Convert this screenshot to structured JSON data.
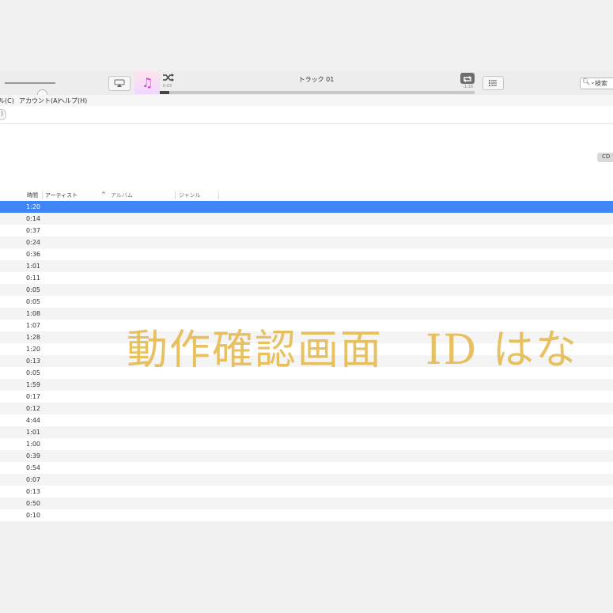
{
  "toolbar": {
    "now_playing_title": "トラック 01",
    "elapsed_time": "0:03",
    "remaining_time": "-1:16",
    "progress": 0.03,
    "volume": 0.62,
    "search_placeholder": "検索"
  },
  "menubar": {
    "items": [
      "ル(C)",
      "アカウント(A)",
      "ヘルプ(H)"
    ]
  },
  "header": {
    "cd_button_label": "CD"
  },
  "columns": {
    "time": "時間",
    "artist": "アーティスト",
    "sort_indicator": "^",
    "album": "アルバム",
    "genre": "ジャンル"
  },
  "tracks": [
    {
      "time": "1:20"
    },
    {
      "time": "0:14"
    },
    {
      "time": "0:37"
    },
    {
      "time": "0:24"
    },
    {
      "time": "0:36"
    },
    {
      "time": "1:01"
    },
    {
      "time": "0:11"
    },
    {
      "time": "0:05"
    },
    {
      "time": "0:05"
    },
    {
      "time": "1:08"
    },
    {
      "time": "1:07"
    },
    {
      "time": "1:28"
    },
    {
      "time": "1:20"
    },
    {
      "time": "0:13"
    },
    {
      "time": "0:05"
    },
    {
      "time": "1:59"
    },
    {
      "time": "0:17"
    },
    {
      "time": "0:12"
    },
    {
      "time": "4:44"
    },
    {
      "time": "1:01"
    },
    {
      "time": "1:00"
    },
    {
      "time": "0:39"
    },
    {
      "time": "0:54"
    },
    {
      "time": "0:07"
    },
    {
      "time": "0:13"
    },
    {
      "time": "0:50"
    },
    {
      "time": "0:10"
    }
  ],
  "selected_index": 0,
  "overlay_text": "動作確認画面　ID はな",
  "colors": {
    "selection": "#3f85f5",
    "overlay": "#e3b23c",
    "music_icon": "#d43cd8"
  }
}
